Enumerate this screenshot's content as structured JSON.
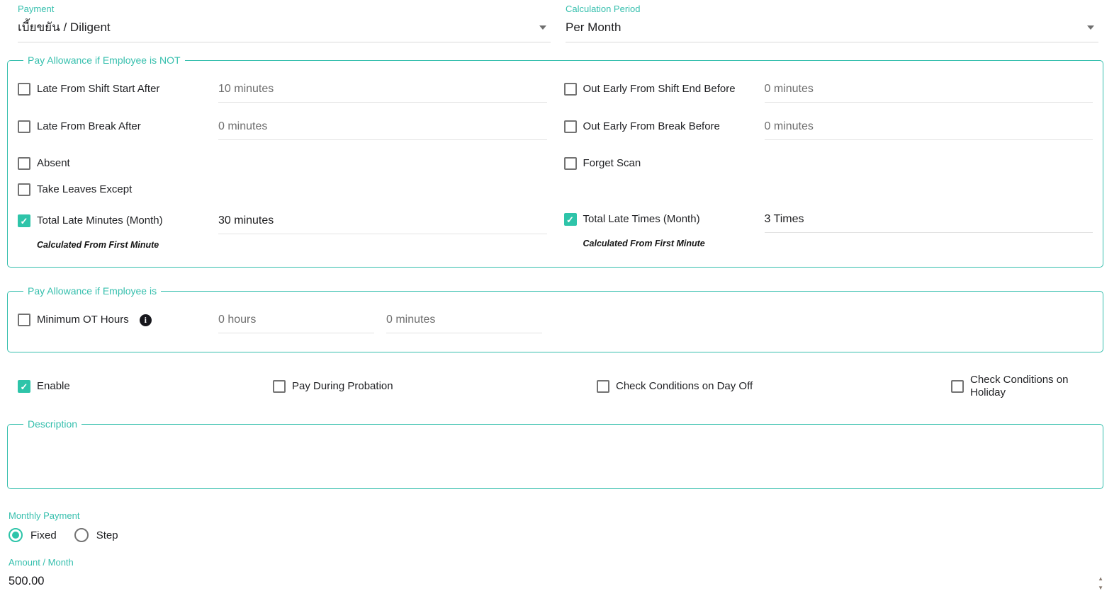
{
  "colors": {
    "accent_teal": "#35bfad",
    "control_teal": "#2ec4a9",
    "text_dark": "#202124",
    "text_disabled": "#6e6e6e",
    "underline_gray": "#e3e3e3"
  },
  "icons": {
    "check": "✓",
    "info": "i",
    "spinner_up": "▲",
    "spinner_down": "▼"
  },
  "top_fields": {
    "payment": {
      "label": "Payment",
      "value": "เบี้ยขยัน / Diligent"
    },
    "calculation_period": {
      "label": "Calculation Period",
      "value": "Per Month"
    }
  },
  "not_section": {
    "legend": "Pay Allowance if Employee is NOT",
    "left": {
      "late_shift": {
        "label": "Late From Shift Start After",
        "value": "10 minutes",
        "checked": false
      },
      "late_break": {
        "label": "Late From Break After",
        "value": "0 minutes",
        "checked": false
      },
      "absent": {
        "label": "Absent",
        "checked": false
      },
      "take_leaves": {
        "label": "Take Leaves Except",
        "checked": false
      },
      "total_late_minutes": {
        "label": "Total Late Minutes (Month)",
        "value": "30 minutes",
        "checked": true,
        "note": "Calculated From First Minute"
      }
    },
    "right": {
      "out_early_shift": {
        "label": "Out Early From Shift End Before",
        "value": "0 minutes",
        "checked": false
      },
      "out_early_break": {
        "label": "Out Early From Break Before",
        "value": "0 minutes",
        "checked": false
      },
      "forget_scan": {
        "label": "Forget Scan",
        "checked": false
      },
      "total_late_times": {
        "label": "Total Late Times (Month)",
        "value": "3 Times",
        "checked": true,
        "note": "Calculated From First Minute"
      }
    }
  },
  "is_section": {
    "legend": "Pay Allowance if Employee is",
    "minimum_ot": {
      "label": "Minimum OT Hours",
      "checked": false,
      "hours_value": "0 hours",
      "minutes_value": "0 minutes"
    }
  },
  "options_row": {
    "enable": {
      "label": "Enable",
      "checked": true
    },
    "pay_during_probation": {
      "label": "Pay During Probation",
      "checked": false
    },
    "check_day_off": {
      "label": "Check Conditions on Day Off",
      "checked": false
    },
    "check_holiday": {
      "label": "Check Conditions on Holiday",
      "checked": false
    }
  },
  "description": {
    "legend": "Description",
    "value": ""
  },
  "monthly_payment": {
    "label": "Monthly Payment",
    "options": [
      {
        "label": "Fixed",
        "selected": true
      },
      {
        "label": "Step",
        "selected": false
      }
    ]
  },
  "amount": {
    "label": "Amount / Month",
    "value": "500.00"
  }
}
